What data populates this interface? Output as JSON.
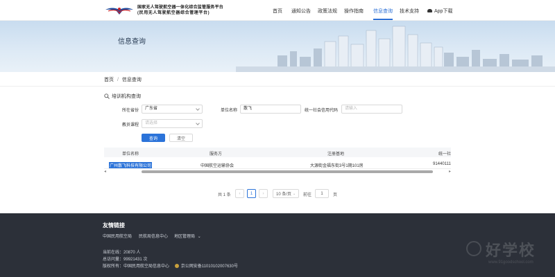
{
  "header": {
    "logo_line1": "国家无人驾驶航空器一体化综合监管服务平台",
    "logo_line2": "(民用无人驾驶航空器综合管理平台)",
    "nav": [
      {
        "label": "首页",
        "active": false
      },
      {
        "label": "通知公告",
        "active": false
      },
      {
        "label": "政策法规",
        "active": false
      },
      {
        "label": "操作指南",
        "active": false
      },
      {
        "label": "信息查询",
        "active": true
      },
      {
        "label": "技术支持",
        "active": false
      },
      {
        "label": "App下载",
        "active": false
      }
    ]
  },
  "banner": {
    "title": "信息查询"
  },
  "breadcrumb": {
    "home": "首页",
    "separator": "/",
    "current": "信息查询"
  },
  "search": {
    "section_title": "培训机构查询",
    "province_label": "所在省份",
    "province_value": "广东省",
    "unit_label": "单位名称",
    "unit_value": "散飞",
    "credit_label": "统一社会信用代码",
    "credit_placeholder": "请输入",
    "course_label": "教员课程",
    "course_placeholder": "请选择",
    "query_button": "查询",
    "reset_button": "清空"
  },
  "table": {
    "columns": [
      "单位名称",
      "服务方",
      "注册基地",
      "统一社"
    ],
    "rows": [
      [
        "广州散飞科技有限公司",
        "中国航空运输协会",
        "大源街金福东街3号1期101房",
        "91440111"
      ]
    ]
  },
  "pagination": {
    "total_text": "共 1 条",
    "current_page": "1",
    "page_size": "10 条/页",
    "goto_prefix": "前往",
    "goto_value": "1",
    "goto_suffix": "页"
  },
  "footer": {
    "title": "友情链接",
    "links": [
      "中国民用航空局",
      "民航局信息中心",
      "地区管理局"
    ],
    "online": "当前在线：20870 人",
    "visits": "总访问量：99921431 次",
    "copyright": "版权所有：中国民用航空局信息中心",
    "icp": "京公网安备11010102007630号",
    "watermark_main": "好学校",
    "watermark_sub": "www.91goodschool.com"
  },
  "colors": {
    "accent": "#2b73d9",
    "footer_bg": "#2c3039"
  },
  "icons": [
    "eagle-logo-icon",
    "download-cloud-icon",
    "magnifier-icon",
    "chevron-down-icon",
    "police-badge-icon"
  ]
}
